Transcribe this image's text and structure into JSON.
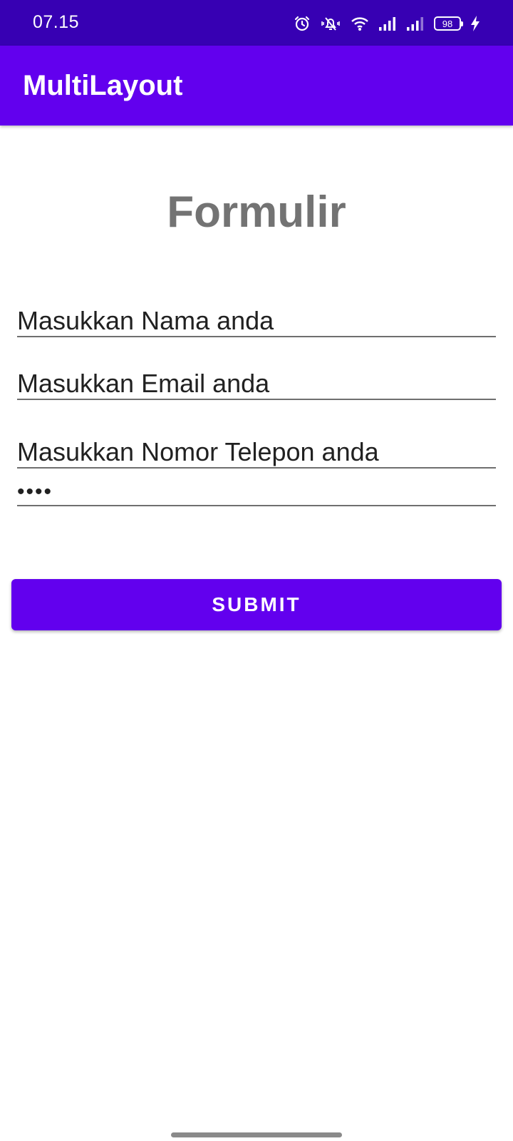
{
  "status_bar": {
    "time": "07.15",
    "battery_level": "98",
    "icons": [
      "alarm-icon",
      "muted-bell-icon",
      "wifi-icon",
      "signal-icon",
      "signal-icon",
      "battery-icon",
      "charging-icon"
    ]
  },
  "app_bar": {
    "title": "MultiLayout"
  },
  "form": {
    "title": "Formulir",
    "name_field": "Masukkan Nama anda",
    "email_field": "Masukkan Email anda",
    "phone_field": "Masukkan Nomor Telepon anda",
    "password_field": "••••",
    "submit_label": "SUBMIT"
  },
  "colors": {
    "status_bar": "#3700b3",
    "primary": "#6200ee",
    "title_gray": "#737373"
  }
}
